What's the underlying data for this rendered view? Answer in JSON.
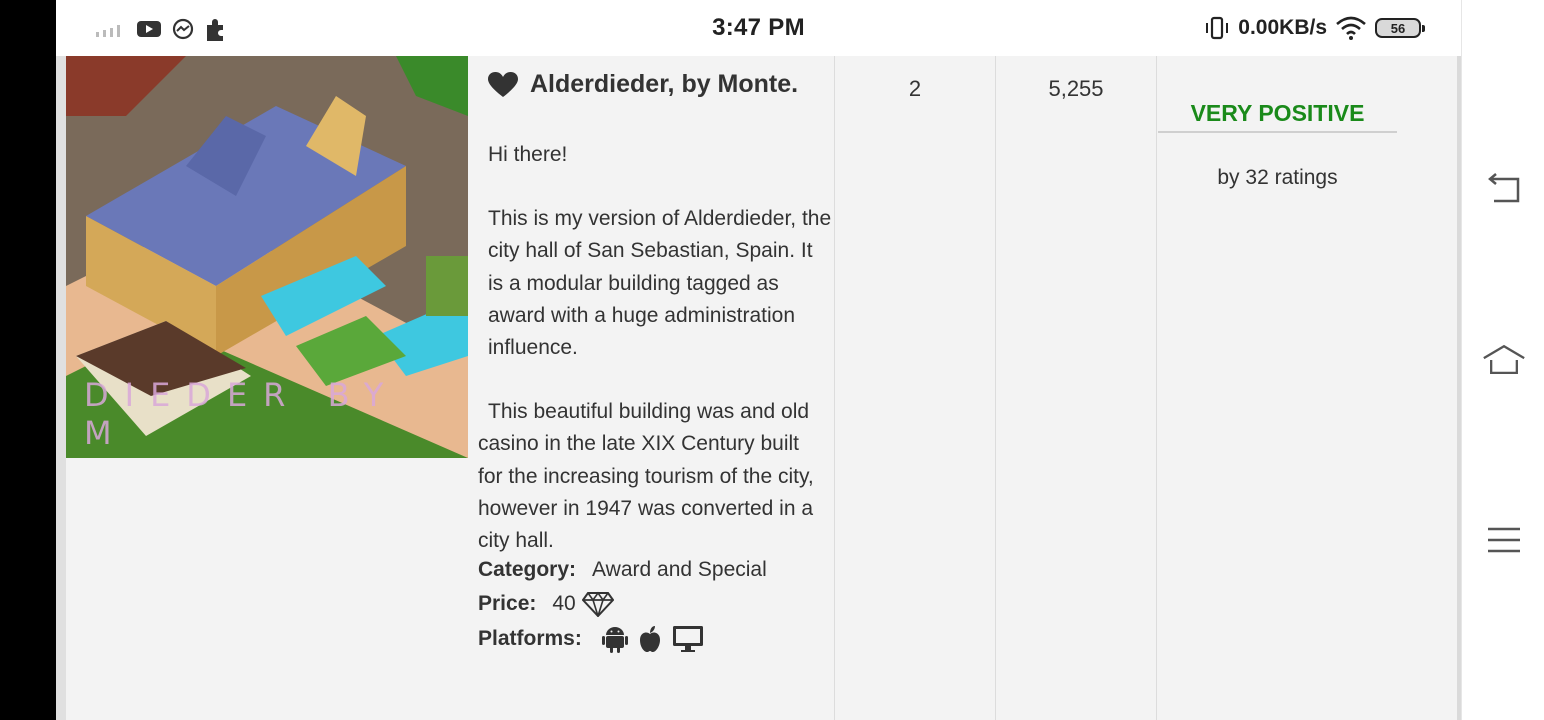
{
  "status_bar": {
    "time": "3:47 PM",
    "network_speed": "0.00KB/s",
    "battery_level": "56",
    "icons": [
      "signal-icon",
      "youtube-icon",
      "messenger-icon",
      "puzzle-icon",
      "vibrate-icon",
      "wifi-icon",
      "battery-icon"
    ]
  },
  "listing": {
    "thumbnail_caption": "DIEDER BY M",
    "title": "Alderdieder, by Monte.",
    "description": [
      "Hi there!",
      "This is my version of Alderdieder, the city hall of San Sebastian, Spain. It is a modular building tagged as award with a huge administration influence.",
      "This beautiful building was and old casino in the late XIX Century built for the increasing tourism of the city, however in 1947 was converted in a city hall."
    ],
    "category_label": "Category:",
    "category_value": "Award and Special",
    "price_label": "Price:",
    "price_value": "40",
    "platforms_label": "Platforms:",
    "platform_icons": [
      "android-icon",
      "apple-icon",
      "desktop-icon"
    ],
    "column_2_value": "2",
    "column_3_value": "5,255",
    "rating_label": "VERY POSITIVE",
    "rating_count": "by 32 ratings"
  },
  "colors": {
    "rating_green": "#1a8a1a",
    "page_bg": "#f3f3f3"
  },
  "nav_buttons": [
    "back-icon",
    "home-icon",
    "menu-icon"
  ]
}
